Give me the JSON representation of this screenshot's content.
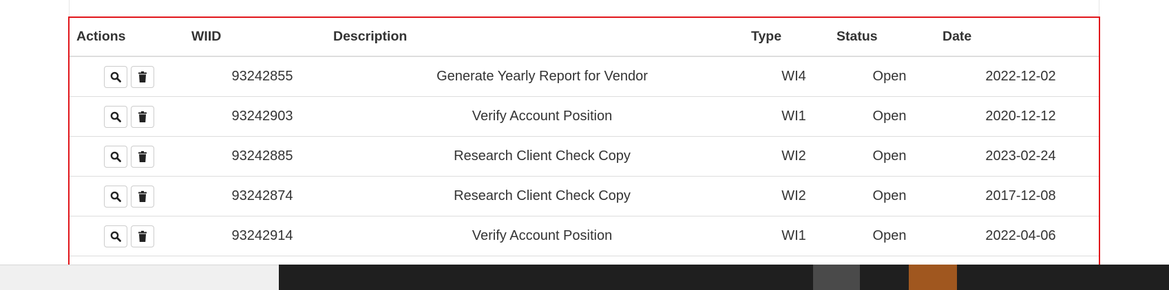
{
  "table": {
    "headers": {
      "actions": "Actions",
      "wiid": "WIID",
      "description": "Description",
      "type": "Type",
      "status": "Status",
      "date": "Date"
    },
    "rows": [
      {
        "wiid": "93242855",
        "description": "Generate Yearly Report for Vendor",
        "type": "WI4",
        "status": "Open",
        "date": "2022-12-02"
      },
      {
        "wiid": "93242903",
        "description": "Verify Account Position",
        "type": "WI1",
        "status": "Open",
        "date": "2020-12-12"
      },
      {
        "wiid": "93242885",
        "description": "Research Client Check Copy",
        "type": "WI2",
        "status": "Open",
        "date": "2023-02-24"
      },
      {
        "wiid": "93242874",
        "description": "Research Client Check Copy",
        "type": "WI2",
        "status": "Open",
        "date": "2017-12-08"
      },
      {
        "wiid": "93242914",
        "description": "Verify Account Position",
        "type": "WI1",
        "status": "Open",
        "date": "2022-04-06"
      }
    ],
    "row_actions": {
      "view_icon": "search-icon",
      "delete_icon": "trash-icon"
    }
  },
  "colors": {
    "highlight_border": "#e1161b",
    "text": "#333333",
    "taskbar": "#1f1f1f",
    "taskbar_accent": "#a0571f"
  }
}
